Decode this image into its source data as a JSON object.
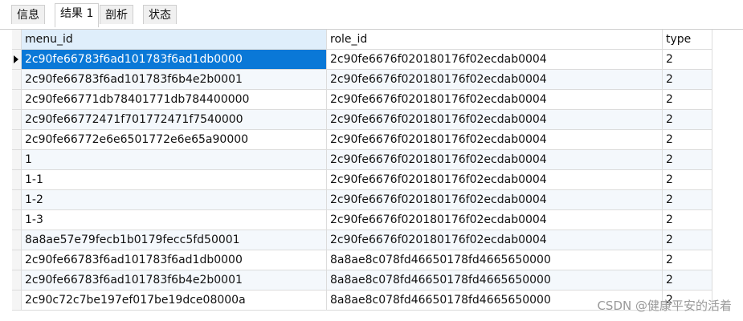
{
  "tabs": [
    {
      "label": "信息",
      "active": false
    },
    {
      "label": "结果 1",
      "active": true
    },
    {
      "label": "剖析",
      "active": false
    },
    {
      "label": "状态",
      "active": false
    }
  ],
  "columns": [
    "menu_id",
    "role_id",
    "type"
  ],
  "rows": [
    [
      "2c90fe66783f6ad101783f6ad1db0000",
      "2c90fe6676f020180176f02ecdab0004",
      "2"
    ],
    [
      "2c90fe66783f6ad101783f6b4e2b0001",
      "2c90fe6676f020180176f02ecdab0004",
      "2"
    ],
    [
      "2c90fe66771db78401771db784400000",
      "2c90fe6676f020180176f02ecdab0004",
      "2"
    ],
    [
      "2c90fe66772471f701772471f7540000",
      "2c90fe6676f020180176f02ecdab0004",
      "2"
    ],
    [
      "2c90fe66772e6e6501772e6e65a90000",
      "2c90fe6676f020180176f02ecdab0004",
      "2"
    ],
    [
      "1",
      "2c90fe6676f020180176f02ecdab0004",
      "2"
    ],
    [
      "1-1",
      "2c90fe6676f020180176f02ecdab0004",
      "2"
    ],
    [
      "1-2",
      "2c90fe6676f020180176f02ecdab0004",
      "2"
    ],
    [
      "1-3",
      "2c90fe6676f020180176f02ecdab0004",
      "2"
    ],
    [
      "8a8ae57e79fecb1b0179fecc5fd50001",
      "2c90fe6676f020180176f02ecdab0004",
      "2"
    ],
    [
      "2c90fe66783f6ad101783f6ad1db0000",
      "8a8ae8c078fd46650178fd4665650000",
      "2"
    ],
    [
      "2c90fe66783f6ad101783f6b4e2b0001",
      "8a8ae8c078fd46650178fd4665650000",
      "2"
    ],
    [
      "2c90c72c7be197ef017be19dce08000a",
      "8a8ae8c078fd46650178fd4665650000",
      "2"
    ]
  ],
  "selected_row": 0,
  "watermark": "CSDN @健康平安的活着",
  "colors": {
    "selection": "#0a78d7",
    "header_highlight": "#dfeefb",
    "alt_row": "#f4f8fc"
  }
}
